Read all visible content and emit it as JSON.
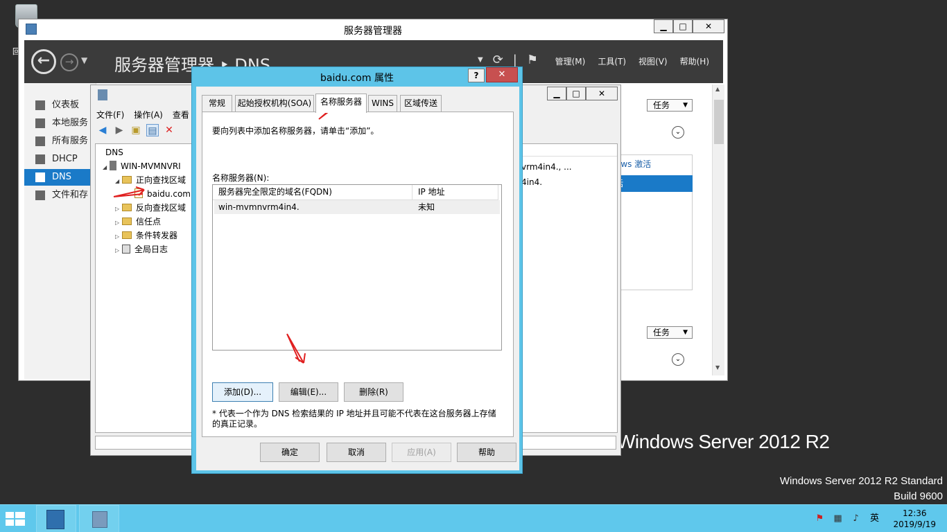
{
  "desktop": {
    "recycle_label": "回",
    "brand": "Windows Server 2012 R2",
    "edition_line1": "Windows Server 2012 R2 Standard",
    "edition_line2": "Build 9600"
  },
  "server_manager": {
    "title": "服务器管理器",
    "breadcrumb": "服务器管理器 ‣ DNS",
    "menus": [
      "管理(M)",
      "工具(T)",
      "视图(V)",
      "帮助(H)"
    ],
    "sidebar": [
      {
        "label": "仪表板",
        "active": false
      },
      {
        "label": "本地服务",
        "active": false
      },
      {
        "label": "所有服务",
        "active": false
      },
      {
        "label": "DHCP",
        "active": false
      },
      {
        "label": "DNS",
        "active": true
      },
      {
        "label": "文件和存",
        "active": false
      }
    ],
    "task_label": "任务",
    "panel_row_text": "ows 激活",
    "panel_row_selected": "括",
    "detail_items": [
      "vrm4in4., ...",
      "4in4."
    ]
  },
  "dns_manager": {
    "menus": [
      "文件(F)",
      "操作(A)",
      "查看"
    ],
    "tree": {
      "root": "DNS",
      "server": "WIN-MVMNVRI",
      "forward": "正向查找区域",
      "zone": "baidu.com",
      "reverse": "反向查找区域",
      "trust": "信任点",
      "conditional": "条件转发器",
      "global_log": "全局日志"
    }
  },
  "dialog": {
    "title": "baidu.com 属性",
    "tabs": [
      "常规",
      "起始授权机构(SOA)",
      "名称服务器",
      "WINS",
      "区域传送"
    ],
    "hint": "要向列表中添加名称服务器，请单击“添加”。",
    "label_ns": "名称服务器(N):",
    "columns": [
      "服务器完全限定的域名(FQDN)",
      "IP 地址"
    ],
    "rows": [
      {
        "fqdn": "win-mvmnvrm4in4.",
        "ip": "未知"
      }
    ],
    "buttons": {
      "add": "添加(D)...",
      "edit": "编辑(E)...",
      "remove": "删除(R)"
    },
    "note": "* 代表一个作为 DNS 检索结果的 IP 地址并且可能不代表在这台服务器上存储的真正记录。",
    "footer": {
      "ok": "确定",
      "cancel": "取消",
      "apply": "应用(A)",
      "help": "帮助"
    }
  },
  "taskbar": {
    "time": "12:36",
    "date": "2019/9/19",
    "ime": "英"
  }
}
